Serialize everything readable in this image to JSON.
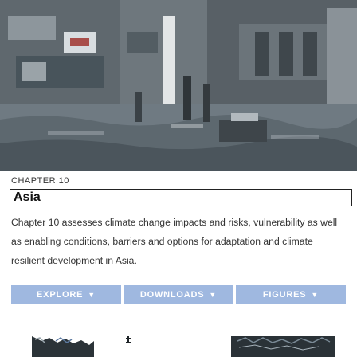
{
  "chapter": {
    "label": "CHAPTER 10",
    "title": "Asia",
    "description": "Chapter 10 assesses climate change impacts and risks, vulnerability as well as enabling conditions, barriers and options for adaptation and climate resilient development in Asia."
  },
  "buttons": [
    {
      "label": "EXPLORE",
      "icon": "chevron-down-icon"
    },
    {
      "label": "DOWNLOADS",
      "icon": "chevron-down-icon"
    },
    {
      "label": "FIGURES",
      "icon": "chevron-down-icon"
    }
  ],
  "colors": {
    "button_bg": "#9fb8e0",
    "title_border": "#222222"
  }
}
